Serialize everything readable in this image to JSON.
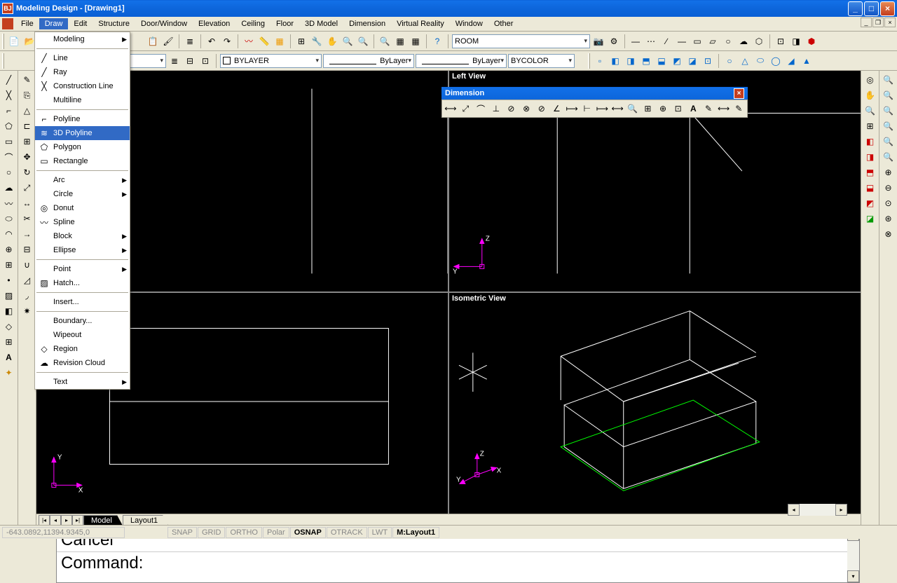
{
  "title": "Modeling Design - [Drawing1]",
  "menubar": [
    "File",
    "Draw",
    "Edit",
    "Structure",
    "Door/Window",
    "Elevation",
    "Ceiling",
    "Floor",
    "3D Model",
    "Dimension",
    "Virtual Reality",
    "Window",
    "Other"
  ],
  "active_menu_index": 1,
  "dropdown": {
    "groups": [
      [
        {
          "label": "Modeling",
          "sub": true
        }
      ],
      [
        {
          "label": "Line"
        },
        {
          "label": "Ray"
        },
        {
          "label": "Construction Line"
        },
        {
          "label": "Multiline"
        }
      ],
      [
        {
          "label": "Polyline"
        },
        {
          "label": "3D Polyline",
          "highlight": true
        },
        {
          "label": "Polygon"
        },
        {
          "label": "Rectangle"
        }
      ],
      [
        {
          "label": "Arc",
          "sub": true
        },
        {
          "label": "Circle",
          "sub": true
        },
        {
          "label": "Donut"
        },
        {
          "label": "Spline"
        },
        {
          "label": "Block",
          "sub": true
        },
        {
          "label": "Ellipse",
          "sub": true
        }
      ],
      [
        {
          "label": "Point",
          "sub": true
        },
        {
          "label": "Hatch..."
        }
      ],
      [
        {
          "label": "Insert..."
        }
      ],
      [
        {
          "label": "Boundary..."
        },
        {
          "label": "Wipeout"
        },
        {
          "label": "Region"
        },
        {
          "label": "Revision Cloud"
        }
      ],
      [
        {
          "label": "Text",
          "sub": true
        }
      ]
    ]
  },
  "toolbar2": {
    "bylayer1": "BYLAYER",
    "bylayer2": "ByLayer",
    "bylayer3": "ByLayer",
    "bycolor": "BYCOLOR"
  },
  "toolbar1_combo": "ROOM",
  "viewport_labels": {
    "top_right": "Left View",
    "bottom_right": "Isometric View"
  },
  "dimension_toolbar_title": "Dimension",
  "tabs": [
    "Model",
    "Layout1"
  ],
  "active_tab": 0,
  "command": {
    "line1": "Cancel",
    "line2": "Command:"
  },
  "status": {
    "coords": "-643.0892,11394.9345,0",
    "toggles": [
      "SNAP",
      "GRID",
      "ORTHO",
      "Polar",
      "OSNAP",
      "OTRACK",
      "LWT",
      "M:Layout1"
    ],
    "active_toggle": 4
  }
}
